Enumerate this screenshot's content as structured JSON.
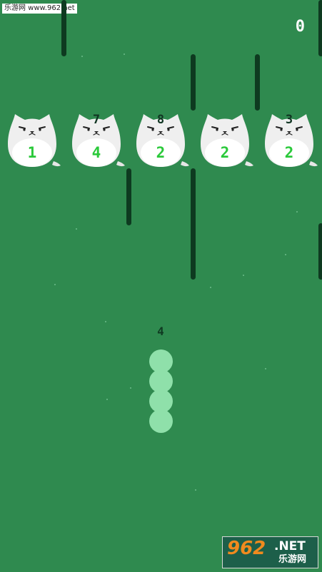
{
  "watermark": {
    "top_text": "乐游网 www.962.net"
  },
  "hud": {
    "score": "0"
  },
  "blocks": [
    {
      "hp": "1",
      "cap": ""
    },
    {
      "hp": "4",
      "cap": "7"
    },
    {
      "hp": "2",
      "cap": "8"
    },
    {
      "hp": "2",
      "cap": ""
    },
    {
      "hp": "2",
      "cap": "3"
    }
  ],
  "snake": {
    "length": "4"
  },
  "brand": {
    "big": "962",
    "net": ".NET",
    "sub": "乐游网"
  },
  "colors": {
    "background": "#2f8a4f",
    "wall": "#0e3a20",
    "block_hp": "#2ac93a",
    "snake": "#8fe0aa",
    "brand_orange": "#f08a1e"
  }
}
